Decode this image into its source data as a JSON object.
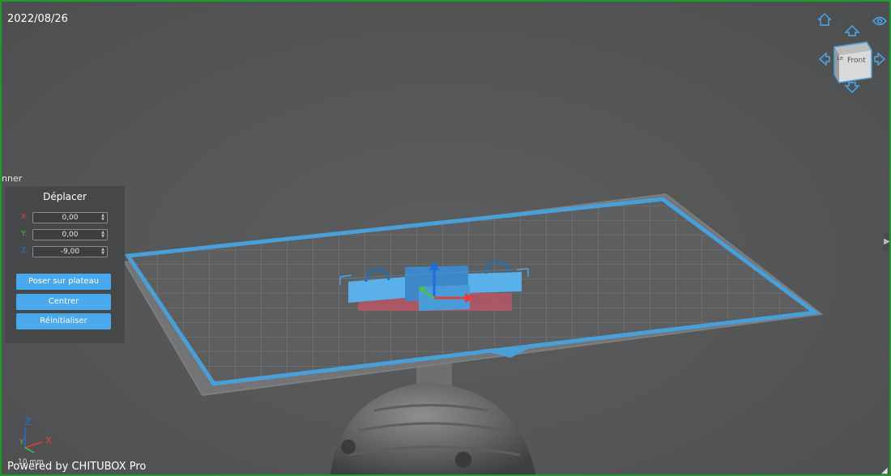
{
  "app": {
    "date": "2022/08/26",
    "powered_by": "Powered by CHITUBOX Pro"
  },
  "sidebar_fragment": {
    "label": "nner"
  },
  "move_panel": {
    "title": "Déplacer",
    "fields": [
      {
        "label": "X:",
        "value": "0,00",
        "color": "#e0413a"
      },
      {
        "label": "Y:",
        "value": "0,00",
        "color": "#44c24a"
      },
      {
        "label": "Z:",
        "value": "-9,00",
        "color": "#3a6fe0"
      }
    ],
    "buttons": {
      "lay_on_plate": "Poser sur plateau",
      "center": "Centrer",
      "reset": "Réinitialiser"
    }
  },
  "view_cube": {
    "face_label": "Front",
    "side_label": "Le"
  },
  "axis_indicator": {
    "z": "Z",
    "x": "X",
    "y": "Y",
    "scale_label": "10 mm"
  },
  "colors": {
    "accent": "#4aa8ec",
    "plate_outline": "#4a9fd8",
    "model": "#5ab0e8",
    "model_support": "#d05a68",
    "axis_x": "#e0413a",
    "axis_y": "#44c24a",
    "axis_z": "#1f6ee0"
  }
}
